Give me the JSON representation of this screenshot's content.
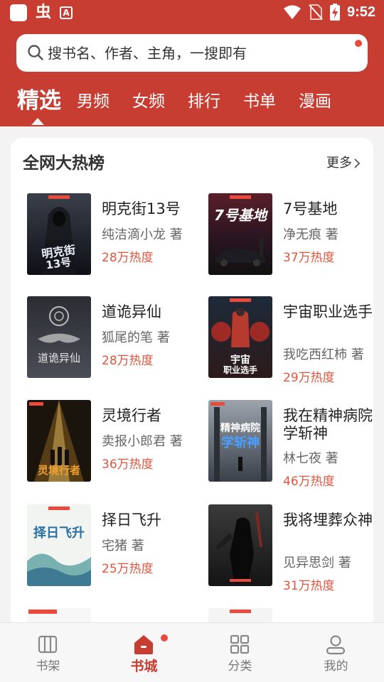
{
  "statusbar": {
    "time": "9:52",
    "app_glyph": "虫",
    "app_badge": "A"
  },
  "search": {
    "placeholder": "搜书名、作者、主角，一搜即有"
  },
  "tabs": [
    {
      "label": "精选",
      "active": true
    },
    {
      "label": "男频"
    },
    {
      "label": "女频"
    },
    {
      "label": "排行"
    },
    {
      "label": "书单"
    },
    {
      "label": "漫画"
    }
  ],
  "section": {
    "title": "全网大热榜",
    "more_label": "更多"
  },
  "books": [
    {
      "title": "明克街13号",
      "author": "纯洁滴小龙 著",
      "heat": "28万热度",
      "cover_text": "明克街13号"
    },
    {
      "title": "7号基地",
      "author": "净无痕 著",
      "heat": "37万热度",
      "cover_text": "7号基地"
    },
    {
      "title": "道诡异仙",
      "author": "狐尾的笔 著",
      "heat": "28万热度",
      "cover_text": "道诡异仙"
    },
    {
      "title": "宇宙职业选手",
      "author": "我吃西红柿 著",
      "heat": "29万热度",
      "cover_text": "宇宙职业选手"
    },
    {
      "title": "灵境行者",
      "author": "卖报小郎君 著",
      "heat": "36万热度",
      "cover_text": "灵境行者"
    },
    {
      "title": "我在精神病院学斩神",
      "author": "林七夜 著",
      "heat": "46万热度",
      "cover_text": "精神病院学斩神"
    },
    {
      "title": "择日飞升",
      "author": "宅猪 著",
      "heat": "25万热度",
      "cover_text": "择日飞升"
    },
    {
      "title": "我将埋葬众神",
      "author": "见异思剑 著",
      "heat": "31万热度",
      "cover_text": ""
    }
  ],
  "nav": [
    {
      "label": "书架",
      "icon": "bookshelf-icon"
    },
    {
      "label": "书城",
      "icon": "store-icon",
      "active": true
    },
    {
      "label": "分类",
      "icon": "category-icon"
    },
    {
      "label": "我的",
      "icon": "profile-icon"
    }
  ],
  "colors": {
    "brand": "#c73d31",
    "heat": "#e0563f",
    "badge": "#e84a3c"
  }
}
